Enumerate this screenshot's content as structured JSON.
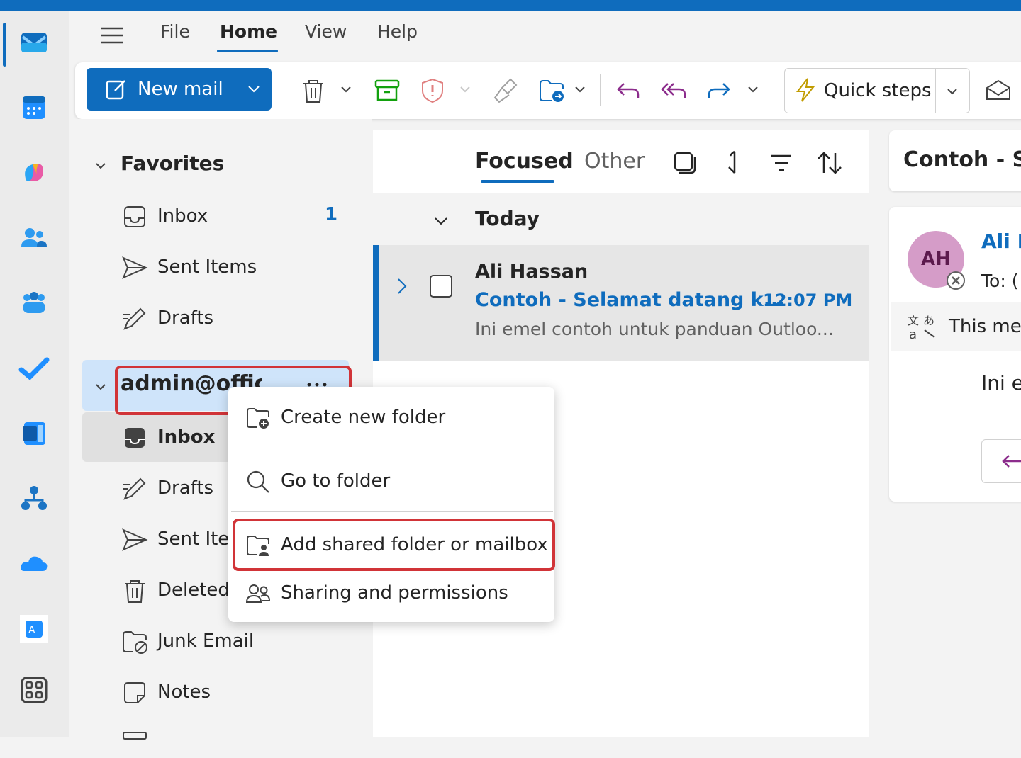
{
  "menu": {
    "tabs": [
      {
        "label": "File"
      },
      {
        "label": "Home"
      },
      {
        "label": "View"
      },
      {
        "label": "Help"
      }
    ]
  },
  "ribbon": {
    "new_mail_label": "New mail",
    "quick_steps_label": "Quick steps"
  },
  "folders": {
    "favorites_label": "Favorites",
    "favorites": [
      {
        "label": "Inbox",
        "count": "1"
      },
      {
        "label": "Sent Items"
      },
      {
        "label": "Drafts"
      }
    ],
    "account_label": "admin@offic",
    "account_folders": [
      {
        "label": "Inbox"
      },
      {
        "label": "Drafts"
      },
      {
        "label": "Sent Iter"
      },
      {
        "label": "Deleted"
      },
      {
        "label": "Junk Email"
      },
      {
        "label": "Notes"
      }
    ]
  },
  "message_list": {
    "tab_focused": "Focused",
    "tab_other": "Other",
    "group_label": "Today",
    "messages": [
      {
        "sender": "Ali Hassan",
        "subject": "Contoh - Selamat datang k...",
        "time": "12:07 PM",
        "preview": "Ini emel contoh untuk panduan Outloo..."
      }
    ]
  },
  "reading_pane": {
    "title": "Contoh - Se",
    "avatar_initials": "AH",
    "sender": "Ali H",
    "to_label": "To: (",
    "notice": "This mes",
    "body": "Ini e"
  },
  "context_menu": {
    "items": [
      {
        "label": "Create new folder",
        "icon": "folder-add-icon"
      },
      {
        "label": "Go to folder",
        "icon": "search-icon"
      },
      {
        "label": "Add shared folder or mailbox",
        "icon": "folder-person-icon"
      },
      {
        "label": "Sharing and permissions",
        "icon": "people-icon"
      }
    ]
  },
  "colors": {
    "accent": "#0f6cbd",
    "highlight_box": "#d13438",
    "avatar_bg": "#d59cc8"
  }
}
